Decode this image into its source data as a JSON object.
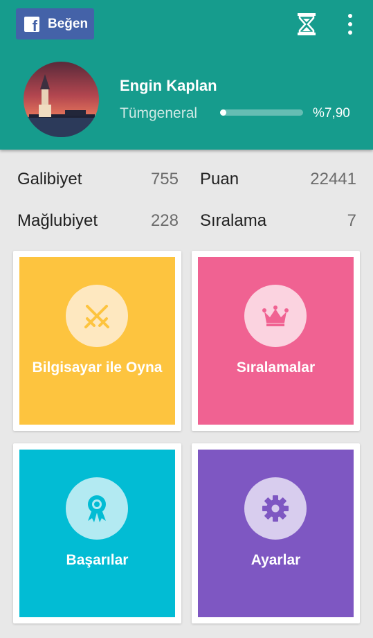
{
  "header": {
    "like_button": "Beğen",
    "player": {
      "name": "Engin Kaplan",
      "rank": "Tümgeneral",
      "progress_percent": 7.9,
      "progress_label": "%7,90"
    }
  },
  "stats": {
    "wins_label": "Galibiyet",
    "wins_value": "755",
    "points_label": "Puan",
    "points_value": "22441",
    "losses_label": "Mağlubiyet",
    "losses_value": "228",
    "ranking_label": "Sıralama",
    "ranking_value": "7"
  },
  "cards": [
    {
      "label": "Bilgisayar ile Oyna",
      "icon": "crossed-swords-icon",
      "color": "#fdc43f"
    },
    {
      "label": "Sıralamalar",
      "icon": "crown-icon",
      "color": "#f06292"
    },
    {
      "label": "Başarılar",
      "icon": "award-ribbon-icon",
      "color": "#02bcd4"
    },
    {
      "label": "Ayarlar",
      "icon": "gear-icon",
      "color": "#7e57c2"
    }
  ],
  "colors": {
    "header_bg": "#169c8d",
    "facebook_blue": "#4462a8",
    "background": "#e8e8e8"
  }
}
